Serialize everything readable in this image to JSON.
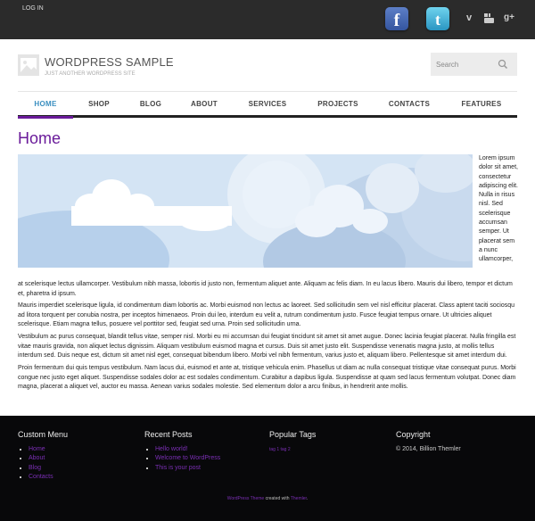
{
  "topbar": {
    "login": "LOG IN",
    "facebook_glyph": "f",
    "twitter_glyph": "t",
    "vimeo_glyph": "v",
    "googleplus_glyph": "g+",
    "icons": [
      "facebook-icon",
      "twitter-icon",
      "vimeo-icon",
      "youtube-icon",
      "google-plus-icon"
    ]
  },
  "header": {
    "title": "WORDPRESS SAMPLE",
    "tagline": "JUST ANOTHER WORDPRESS SITE",
    "search_placeholder": "Search"
  },
  "nav": {
    "items": [
      {
        "label": "HOME",
        "active": true
      },
      {
        "label": "SHOP"
      },
      {
        "label": "BLOG"
      },
      {
        "label": "ABOUT"
      },
      {
        "label": "SERVICES"
      },
      {
        "label": "PROJECTS"
      },
      {
        "label": "CONTACTS"
      },
      {
        "label": "FEATURES"
      }
    ]
  },
  "content": {
    "title": "Home",
    "side_text": "Lorem ipsum dolor sit amet, consectetur adipiscing elit. Nulla in risus nisl. Sed scelerisque accumsan semper. Ut placerat sem a nunc ullamcorper,",
    "under_text": "at scelerisque lectus ullamcorper. Vestibulum nibh massa, lobortis id justo non, fermentum aliquet ante. Aliquam ac felis diam. In eu lacus libero. Mauris dui libero, tempor et dictum et, pharetra id ipsum.",
    "paragraphs": [
      "Mauris imperdiet scelerisque ligula, id condimentum diam lobortis ac. Morbi euismod non lectus ac laoreet. Sed sollicitudin sem vel nisl efficitur placerat. Class aptent taciti sociosqu ad litora torquent per conubia nostra, per inceptos himenaeos. Proin dui leo, interdum eu velit a, rutrum condimentum justo. Fusce feugiat tempus ornare. Ut ultricies aliquet scelerisque. Etiam magna tellus, posuere vel porttitor sed, feugiat sed urna. Proin sed sollicitudin urna.",
      "Vestibulum ac purus consequat, blandit tellus vitae, semper nisl. Morbi eu mi accumsan dui feugiat tincidunt sit amet sit amet augue. Donec lacinia feugiat placerat. Nulla fringilla est vitae mauris gravida, non aliquet lectus dignissim. Aliquam vestibulum euismod magna et cursus. Duis sit amet justo elit. Suspendisse venenatis magna justo, at mollis tellus interdum sed. Duis neque est, dictum sit amet nisl eget, consequat bibendum libero. Morbi vel nibh fermentum, varius justo et, aliquam libero. Pellentesque sit amet interdum dui.",
      "Proin fermentum dui quis tempus vestibulum. Nam lacus dui, euismod et ante at, tristique vehicula enim. Phasellus ut diam ac nulla consequat tristique vitae consequat purus. Morbi congue nec justo eget aliquet. Suspendisse sodales dolor ac est sodales condimentum. Curabitur a dapibus ligula. Suspendisse at quam sed lacus fermentum volutpat. Donec diam magna, placerat a aliquet vel, auctor eu massa. Aenean varius sodales molestie. Sed elementum dolor a arcu finibus, in hendrerit ante mollis."
    ]
  },
  "footer": {
    "custom_menu": {
      "title": "Custom Menu",
      "items": [
        "Home",
        "About",
        "Blog",
        "Contacts"
      ]
    },
    "recent_posts": {
      "title": "Recent Posts",
      "items": [
        "Hello world!",
        "Welcome to WordPress",
        "This is your post"
      ]
    },
    "popular_tags": {
      "title": "Popular Tags",
      "tags": "tag 1  tag 2"
    },
    "copyright": {
      "title": "Copyright",
      "text": "© 2014, Billion Themler"
    },
    "credit": {
      "link1": "WordPress Theme",
      "middle": " created with ",
      "link2": "Themler",
      "end": "."
    }
  },
  "colors": {
    "accent": "#6a1b9a",
    "nav_active": "#3a8fc0",
    "topbar": "#2b2b2b",
    "footer": "#08080a",
    "link": "#7b2fb5"
  }
}
